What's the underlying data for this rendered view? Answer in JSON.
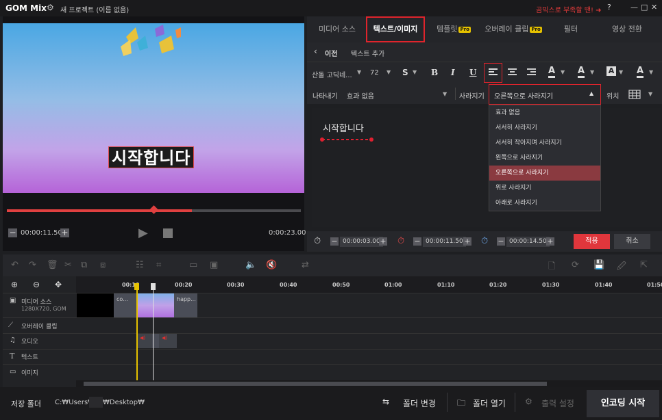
{
  "app": {
    "logo": "GOM Mix",
    "project_name": "새 프로젝트 (이름 없음)",
    "promo": "곰믹스로 부족할 땐! ➜",
    "help": "?",
    "min": "—",
    "max": "□",
    "close": "✕"
  },
  "preview": {
    "overlay_text": "시작합니다",
    "progress_fraction": 0.63,
    "current_time": "00:00:11.50",
    "total_time": "0:00:23.00",
    "minus": "−",
    "plus": "+"
  },
  "tabs": [
    {
      "label": "미디어 소스"
    },
    {
      "label": "텍스트/이미지"
    },
    {
      "label": "템플릿",
      "badge": "Pro"
    },
    {
      "label": "오버레이 클립",
      "badge": "Pro"
    },
    {
      "label": "필터"
    },
    {
      "label": "영상 전환"
    }
  ],
  "breadcrumb": {
    "back": "이전",
    "title": "텍스트 추가"
  },
  "toolbar": {
    "font": "산돌 고딕네...",
    "size": "72",
    "style_s": "S",
    "bold": "B",
    "italic": "I",
    "underline": "U",
    "text_color": "A",
    "outline": "A",
    "bg": "A",
    "shadow": "A"
  },
  "anim": {
    "appear_label": "나타내기",
    "appear_value": "효과 없음",
    "disappear_label": "사라지기",
    "disappear_value": "오른쪽으로 사라지기",
    "position_label": "위치"
  },
  "editor": {
    "text": "시작합니다"
  },
  "dropdown": {
    "items": [
      "효과 없음",
      "서서히 사라지기",
      "서서히 작아지며 사라지기",
      "왼쪽으로 사라지기",
      "오른쪽으로 사라지기",
      "위로 사라지기",
      "아래로 사라지기"
    ],
    "selected_index": 4
  },
  "timefields": {
    "duration": "00:00:03.00",
    "start": "00:00:11.50",
    "end": "00:00:14.50",
    "apply": "적용",
    "cancel": "취소"
  },
  "timeline": {
    "ruler": [
      "00:10",
      "00:20",
      "00:30",
      "00:40",
      "00:50",
      "01:00",
      "01:10",
      "01:20",
      "01:30",
      "01:40",
      "01:50"
    ],
    "tracks": [
      {
        "label": "미디어 소스",
        "sub": "1280X720, GOM"
      },
      {
        "label": "오버레이 클립"
      },
      {
        "label": "오디오"
      },
      {
        "label": "텍스트"
      },
      {
        "label": "이미지"
      }
    ],
    "clips": {
      "media1": "co...",
      "media2": "happ..."
    }
  },
  "bottom": {
    "save_folder_label": "저장 폴더",
    "path_a": "C:₩Users₩",
    "path_b": "₩Desktop₩",
    "change_folder": "폴더 변경",
    "open_folder": "폴더 열기",
    "output_settings": "출력 설정",
    "encode": "인코딩 시작"
  },
  "colors": {
    "accent": "#e0242c",
    "seek": "#e04040",
    "dd_selected": "#8a3a40"
  }
}
